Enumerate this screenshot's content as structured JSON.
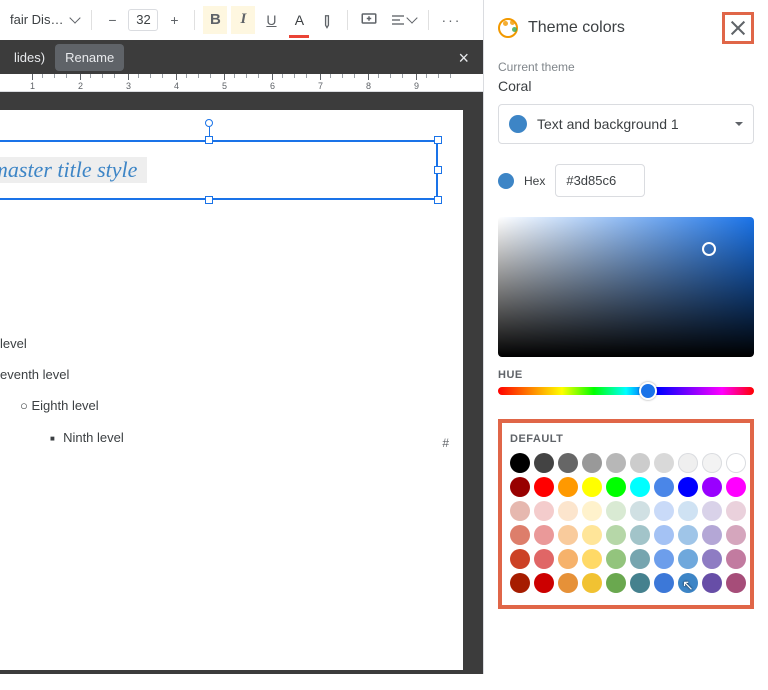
{
  "toolbar": {
    "font_name": "fair Dis…",
    "font_size": "32",
    "minus": "−",
    "plus": "+",
    "bold": "B",
    "italic": "I",
    "underline": "U",
    "color_letter": "A",
    "more": "···"
  },
  "tabs": {
    "left": "lides)",
    "right": "Rename"
  },
  "ruler_ticks": [
    "1",
    "2",
    "3",
    "4",
    "5",
    "6",
    "7",
    "8",
    "9"
  ],
  "slide": {
    "title_text": "master title style",
    "outline_level": "level",
    "outline_seventh": "eventh level",
    "outline_eighth": "Eighth level",
    "outline_ninth": "Ninth level",
    "page_hash": "#"
  },
  "panel": {
    "title": "Theme colors",
    "current_label": "Current theme",
    "theme_name": "Coral",
    "dropdown_label": "Text and background 1",
    "hex_label": "Hex",
    "hex_value": "#3d85c6",
    "hue_label": "HUE",
    "default_label": "DEFAULT",
    "swatches_row1": [
      "#000000",
      "#434343",
      "#666666",
      "#999999",
      "#b7b7b7",
      "#cccccc",
      "#d9d9d9",
      "#efefef",
      "#f3f3f3",
      "#ffffff"
    ],
    "swatches_row2": [
      "#980000",
      "#ff0000",
      "#ff9900",
      "#ffff00",
      "#00ff00",
      "#00ffff",
      "#4a86e8",
      "#0000ff",
      "#9900ff",
      "#ff00ff"
    ],
    "swatches_row3": [
      "#e6b8af",
      "#f4cccc",
      "#fce5cd",
      "#fff2cc",
      "#d9ead3",
      "#d0e0e3",
      "#c9daf8",
      "#cfe2f3",
      "#d9d2e9",
      "#ead1dc"
    ],
    "swatches_row4": [
      "#dd7e6b",
      "#ea9999",
      "#f9cb9c",
      "#ffe599",
      "#b6d7a8",
      "#a2c4c9",
      "#a4c2f4",
      "#9fc5e8",
      "#b4a7d6",
      "#d5a6bd"
    ],
    "swatches_row5": [
      "#cc4125",
      "#e06666",
      "#f6b26b",
      "#ffd966",
      "#93c47d",
      "#76a5af",
      "#6d9eeb",
      "#6fa8dc",
      "#8e7cc3",
      "#c27ba0"
    ],
    "swatches_row6": [
      "#a61c00",
      "#cc0000",
      "#e69138",
      "#f1c232",
      "#6aa84f",
      "#45818e",
      "#3c78d8",
      "#3d85c6",
      "#674ea7",
      "#a64d79"
    ]
  }
}
